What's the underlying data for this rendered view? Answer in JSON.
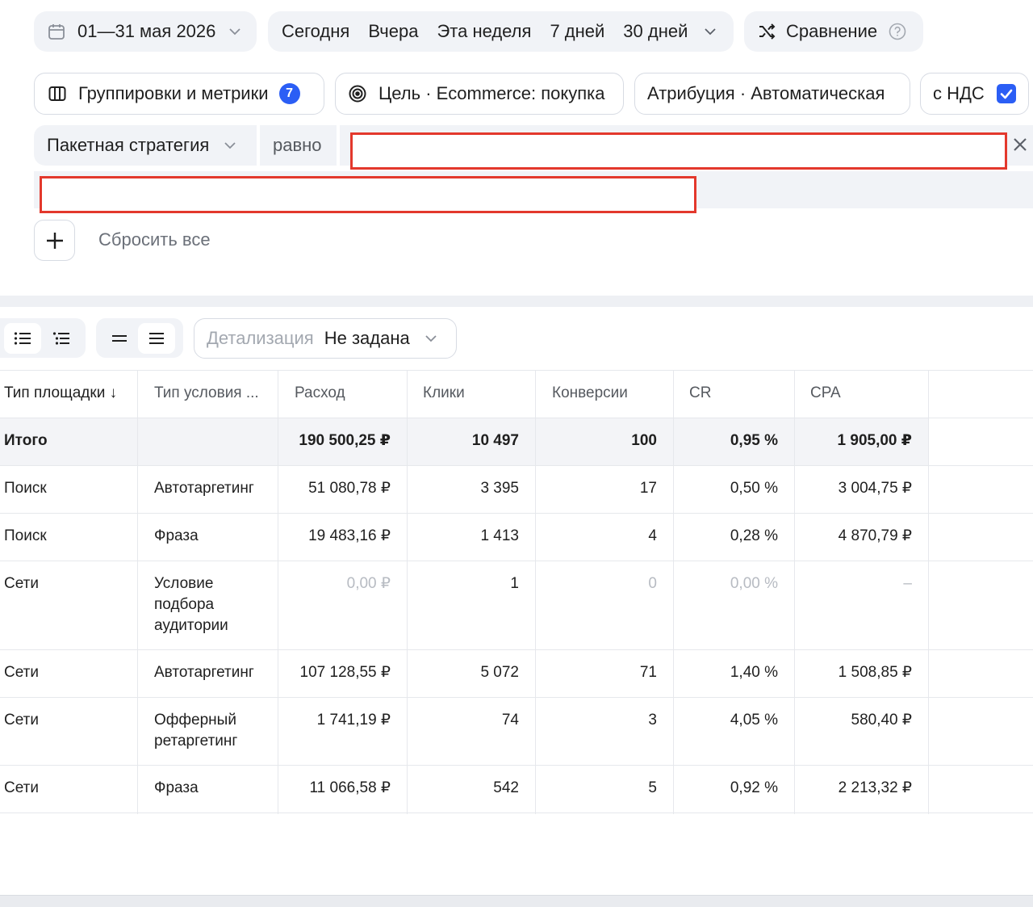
{
  "date_range": {
    "label": "01—31 мая 2026"
  },
  "quick_periods": [
    "Сегодня",
    "Вчера",
    "Эта неделя",
    "7 дней",
    "30 дней"
  ],
  "comparison": {
    "label": "Сравнение"
  },
  "groupings": {
    "label": "Группировки и метрики",
    "badge": "7"
  },
  "goal": {
    "label": "Цель · Ecommerce: покупка"
  },
  "attribution": {
    "label": "Атрибуция · Автоматическая"
  },
  "vat": {
    "label": "с НДС",
    "checked": true
  },
  "filter": {
    "field": "Пакетная стратегия",
    "operator": "равно"
  },
  "reset_all": "Сбросить все",
  "detail": {
    "label": "Детализация",
    "value": "Не задана"
  },
  "table": {
    "headers": [
      "Тип площадки ↓",
      "Тип условия ...",
      "Расход",
      "Клики",
      "Конверсии",
      "CR",
      "CPA"
    ],
    "total": {
      "label": "Итого",
      "spend": "190 500,25 ₽",
      "clicks": "10 497",
      "conv": "100",
      "cr": "0,95 %",
      "cpa": "1 905,00 ₽"
    },
    "rows": [
      {
        "site": "Поиск",
        "cond1": "Автотаргетинг",
        "cond2": "",
        "cond3": "",
        "spend": "51 080,78 ₽",
        "clicks": "3 395",
        "conv": "17",
        "cr": "0,50 %",
        "cpa": "3 004,75 ₽"
      },
      {
        "site": "Поиск",
        "cond1": "Фраза",
        "cond2": "",
        "cond3": "",
        "spend": "19 483,16 ₽",
        "clicks": "1 413",
        "conv": "4",
        "cr": "0,28 %",
        "cpa": "4 870,79 ₽"
      },
      {
        "site": "Сети",
        "cond1": "Условие",
        "cond2": "подбора",
        "cond3": "аудитории",
        "spend": "0,00 ₽",
        "clicks": "1",
        "conv": "0",
        "cr": "0,00 %",
        "cpa": "–"
      },
      {
        "site": "Сети",
        "cond1": "Автотаргетинг",
        "cond2": "",
        "cond3": "",
        "spend": "107 128,55 ₽",
        "clicks": "5 072",
        "conv": "71",
        "cr": "1,40 %",
        "cpa": "1 508,85 ₽"
      },
      {
        "site": "Сети",
        "cond1": "Офферный",
        "cond2": "ретаргетинг",
        "cond3": "",
        "spend": "1 741,19 ₽",
        "clicks": "74",
        "conv": "3",
        "cr": "4,05 %",
        "cpa": "580,40 ₽"
      },
      {
        "site": "Сети",
        "cond1": "Фраза",
        "cond2": "",
        "cond3": "",
        "spend": "11 066,58 ₽",
        "clicks": "542",
        "conv": "5",
        "cr": "0,92 %",
        "cpa": "2 213,32 ₽"
      }
    ]
  },
  "colors": {
    "accent": "#2b5ef5",
    "highlight_border": "#e3382c",
    "chip_bg": "#f1f3f7"
  }
}
